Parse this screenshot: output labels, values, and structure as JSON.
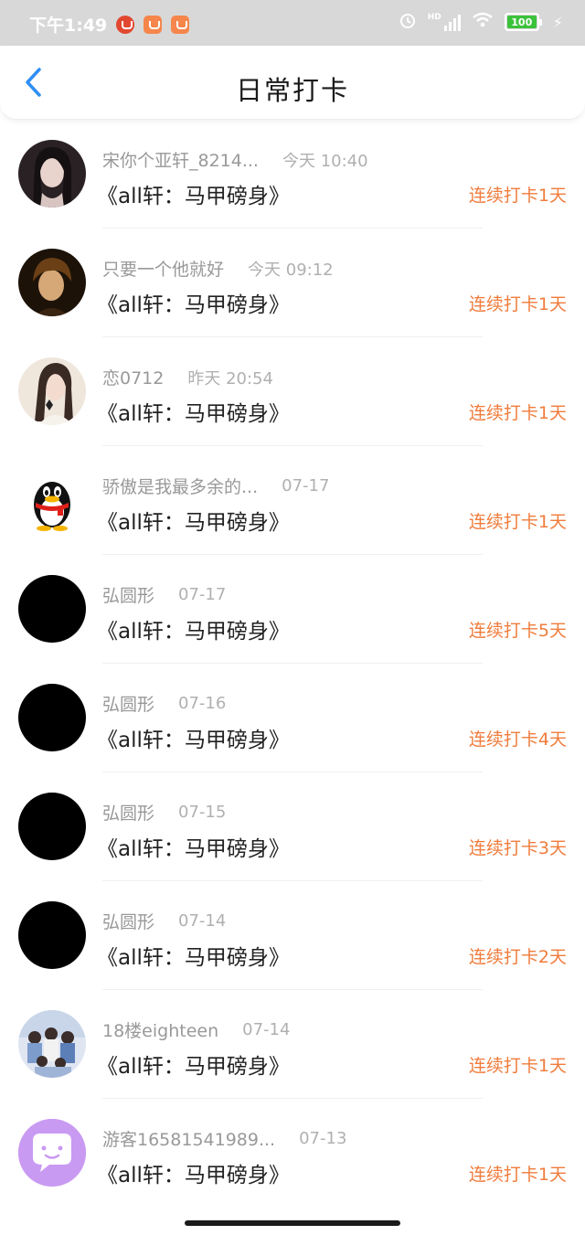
{
  "status_bar": {
    "time": "下午1:49",
    "battery": "100",
    "hd_label": "HD"
  },
  "header": {
    "title": "日常打卡",
    "back_icon": "chevron-left-icon"
  },
  "colors": {
    "accent_orange": "#f07c3c",
    "back_blue": "#2f8ff5",
    "avatar_purple": "#c99af2"
  },
  "entries": [
    {
      "username": "宋你个亚轩_8214...",
      "time": "今天 10:40",
      "book": "《all轩：马甲磅身》",
      "streak": "连续打卡1天",
      "avatar": "photo-girl"
    },
    {
      "username": "只要一个他就好",
      "time": "今天 09:12",
      "book": "《all轩：马甲磅身》",
      "streak": "连续打卡1天",
      "avatar": "photo-boy"
    },
    {
      "username": "恋0712",
      "time": "昨天 20:54",
      "book": "《all轩：马甲磅身》",
      "streak": "连续打卡1天",
      "avatar": "photo-girl-light"
    },
    {
      "username": "骄傲是我最多余的...",
      "time": "07-17",
      "book": "《all轩：马甲磅身》",
      "streak": "连续打卡1天",
      "avatar": "penguin"
    },
    {
      "username": "弘圆形",
      "time": "07-17",
      "book": "《all轩：马甲磅身》",
      "streak": "连续打卡5天",
      "avatar": "black-circle"
    },
    {
      "username": "弘圆形",
      "time": "07-16",
      "book": "《all轩：马甲磅身》",
      "streak": "连续打卡4天",
      "avatar": "black-circle"
    },
    {
      "username": "弘圆形",
      "time": "07-15",
      "book": "《all轩：马甲磅身》",
      "streak": "连续打卡3天",
      "avatar": "black-circle"
    },
    {
      "username": "弘圆形",
      "time": "07-14",
      "book": "《all轩：马甲磅身》",
      "streak": "连续打卡2天",
      "avatar": "black-circle"
    },
    {
      "username": "18楼eighteen",
      "time": "07-14",
      "book": "《all轩：马甲磅身》",
      "streak": "连续打卡1天",
      "avatar": "photo-group"
    },
    {
      "username": "游客16581541989...",
      "time": "07-13",
      "book": "《all轩：马甲磅身》",
      "streak": "连续打卡1天",
      "avatar": "chat-bubble"
    }
  ]
}
